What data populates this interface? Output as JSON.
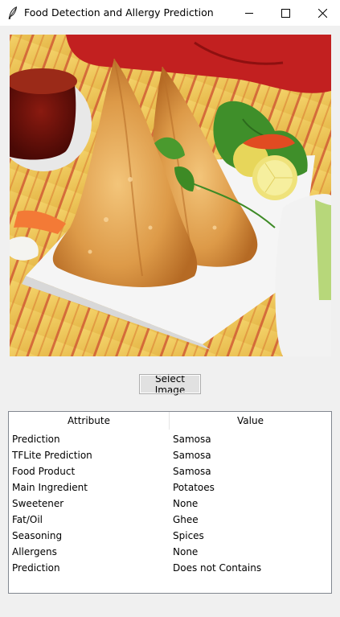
{
  "window": {
    "title": "Food Detection and Allergy Prediction"
  },
  "icons": {
    "app": "feather-icon",
    "minimize": "minimize-icon",
    "maximize": "maximize-icon",
    "close": "close-icon"
  },
  "image": {
    "subject": "samosa-photo"
  },
  "button": {
    "select_label": "Select Image"
  },
  "table": {
    "columns": [
      "Attribute",
      "Value"
    ],
    "rows": [
      {
        "attribute": "Prediction",
        "value": "Samosa"
      },
      {
        "attribute": "TFLite Prediction",
        "value": "Samosa"
      },
      {
        "attribute": "Food Product",
        "value": "Samosa"
      },
      {
        "attribute": "Main Ingredient",
        "value": "Potatoes"
      },
      {
        "attribute": "Sweetener",
        "value": "None"
      },
      {
        "attribute": "Fat/Oil",
        "value": "Ghee"
      },
      {
        "attribute": "Seasoning",
        "value": "Spices"
      },
      {
        "attribute": "Allergens",
        "value": "None"
      },
      {
        "attribute": "Prediction",
        "value": "Does not Contains"
      }
    ]
  }
}
